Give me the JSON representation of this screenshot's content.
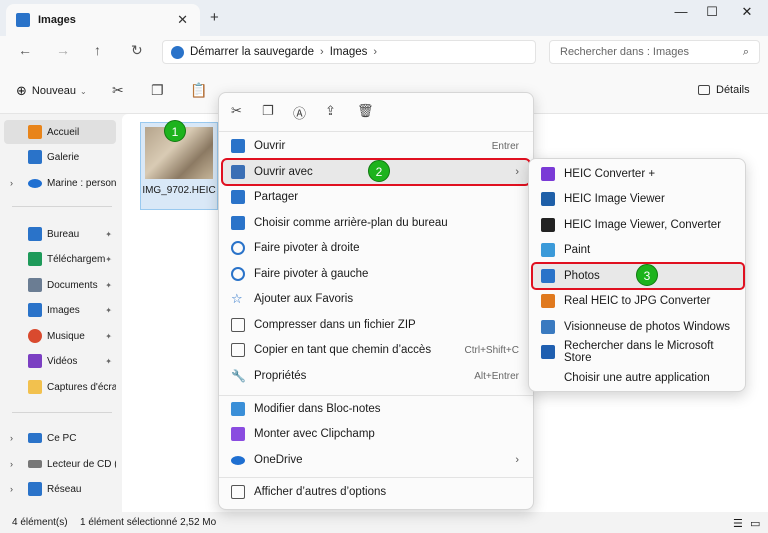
{
  "window": {
    "tab_title": "Images",
    "close_tab": "✕",
    "new_tab": "+",
    "minimize": "—",
    "maximize": "☐",
    "close": "✕"
  },
  "address": {
    "back": "←",
    "forward": "→",
    "up": "↑",
    "refresh": "↻",
    "backup_label": "Démarrer la sauvegarde",
    "current_folder": "Images",
    "search_placeholder": "Rechercher dans : Images"
  },
  "toolbar": {
    "new_label": "Nouveau",
    "details_label": "Détails"
  },
  "sidebar": {
    "items": [
      {
        "label": "Accueil",
        "icon": "home-icon",
        "color": "#e8841a"
      },
      {
        "label": "Galerie",
        "icon": "gallery-icon",
        "color": "#2a73c9"
      },
      {
        "label": "Marine : personi",
        "icon": "onedrive-icon",
        "color": "#1f6fd1"
      },
      {
        "label": "Bureau",
        "icon": "desktop-icon",
        "color": "#2a73c9"
      },
      {
        "label": "Téléchargem",
        "icon": "download-icon",
        "color": "#1e9a5a"
      },
      {
        "label": "Documents",
        "icon": "documents-icon",
        "color": "#6b7d93"
      },
      {
        "label": "Images",
        "icon": "pictures-icon",
        "color": "#2a73c9"
      },
      {
        "label": "Musique",
        "icon": "music-icon",
        "color": "#d94a2e"
      },
      {
        "label": "Vidéos",
        "icon": "videos-icon",
        "color": "#7b3fc2"
      },
      {
        "label": "Captures d'écra",
        "icon": "folder-icon",
        "color": "#f2c14e"
      },
      {
        "label": "Ce PC",
        "icon": "pc-icon",
        "color": "#2a73c9"
      },
      {
        "label": "Lecteur de CD (I",
        "icon": "cd-drive-icon",
        "color": "#777777"
      },
      {
        "label": "Réseau",
        "icon": "network-icon",
        "color": "#2a73c9"
      }
    ],
    "pin": "📌"
  },
  "content": {
    "file_name": "IMG_9702.HEIC"
  },
  "status": {
    "count": "4 élément(s)",
    "selection": "1 élément sélectionné  2,52 Mo"
  },
  "context_menu": {
    "items": [
      {
        "label": "Ouvrir",
        "shortcut": "Entrer",
        "icon": "photos-icon",
        "color": "#2a73c9"
      },
      {
        "label": "Ouvrir avec",
        "shortcut": "",
        "icon": "open-with-icon",
        "color": "#3b6fb5"
      },
      {
        "label": "Partager",
        "shortcut": "",
        "icon": "share-icon",
        "color": "#2a73c9"
      },
      {
        "label": "Choisir comme arrière-plan du bureau",
        "shortcut": "",
        "icon": "wallpaper-icon",
        "color": "#2a73c9"
      },
      {
        "label": "Faire pivoter à droite",
        "shortcut": "",
        "icon": "rotate-right-icon",
        "color": "#2a73c9"
      },
      {
        "label": "Faire pivoter à gauche",
        "shortcut": "",
        "icon": "rotate-left-icon",
        "color": "#2a73c9"
      },
      {
        "label": "Ajouter aux Favoris",
        "shortcut": "",
        "icon": "star-icon",
        "color": "#2a73c9"
      },
      {
        "label": "Compresser dans un fichier ZIP",
        "shortcut": "",
        "icon": "zip-icon",
        "color": "#555555"
      },
      {
        "label": "Copier en tant que chemin d’accès",
        "shortcut": "Ctrl+Shift+C",
        "icon": "copy-path-icon",
        "color": "#555555"
      },
      {
        "label": "Propriétés",
        "shortcut": "Alt+Entrer",
        "icon": "wrench-icon",
        "color": "#555555"
      },
      {
        "label": "Modifier dans Bloc-notes",
        "shortcut": "",
        "icon": "notepad-icon",
        "color": "#3a8fd8"
      },
      {
        "label": "Monter avec Clipchamp",
        "shortcut": "",
        "icon": "clipchamp-icon",
        "color": "#8a4ce0"
      },
      {
        "label": "OneDrive",
        "shortcut": "",
        "icon": "onedrive-icon",
        "color": "#1f6fd1"
      },
      {
        "label": "Afficher d’autres d’options",
        "shortcut": "",
        "icon": "more-options-icon",
        "color": "#555555"
      }
    ],
    "top_icons": [
      "cut-icon",
      "copy-icon",
      "rename-icon",
      "share-icon",
      "delete-icon"
    ]
  },
  "submenu": {
    "items": [
      {
        "label": "HEIC Converter +",
        "icon": "heic-converter-icon",
        "color": "#7a3ad6"
      },
      {
        "label": "HEIC Image Viewer",
        "icon": "heic-viewer-icon",
        "color": "#1e5fa8"
      },
      {
        "label": "HEIC Image Viewer, Converter",
        "icon": "heic-viewer-converter-icon",
        "color": "#222222"
      },
      {
        "label": "Paint",
        "icon": "paint-icon",
        "color": "#3b9ad9"
      },
      {
        "label": "Photos",
        "icon": "photos-icon",
        "color": "#2a73c9"
      },
      {
        "label": "Real HEIC to JPG Converter",
        "icon": "jpg-converter-icon",
        "color": "#e0791e"
      },
      {
        "label": "Visionneuse de photos Windows",
        "icon": "photo-viewer-icon",
        "color": "#3a7ac0"
      },
      {
        "label": "Rechercher dans le Microsoft Store",
        "icon": "store-icon",
        "color": "#1f5fb0"
      },
      {
        "label": "Choisir une autre application",
        "icon": "",
        "color": ""
      }
    ]
  },
  "badges": [
    "1",
    "2",
    "3"
  ]
}
